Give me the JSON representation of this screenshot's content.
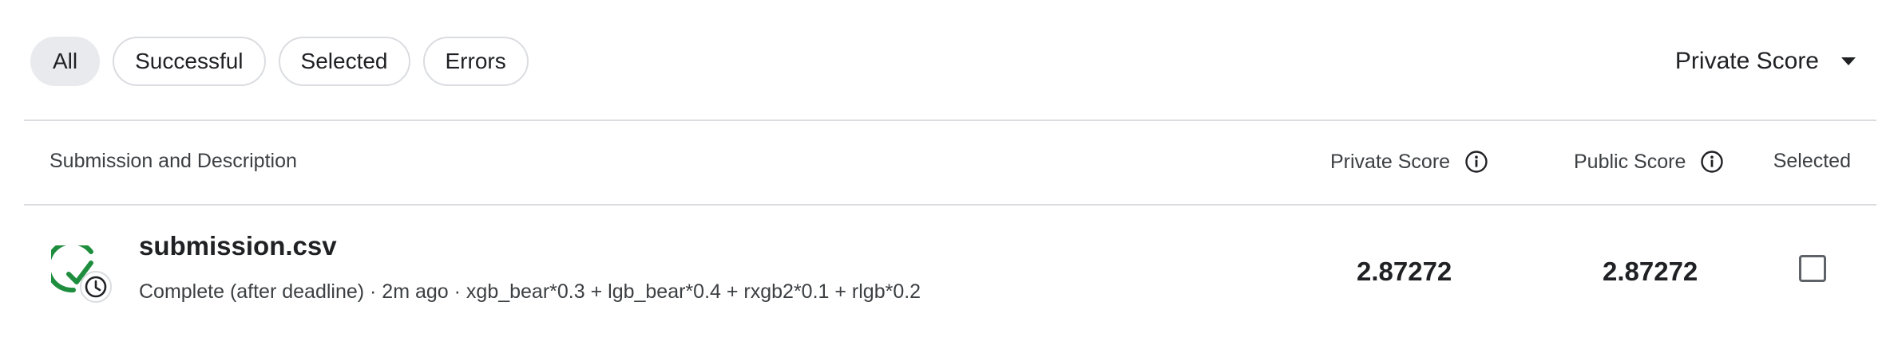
{
  "filters": {
    "all": "All",
    "successful": "Successful",
    "selected": "Selected",
    "errors": "Errors",
    "active": "All"
  },
  "sort": {
    "label": "Private Score",
    "icon": "caret-down-icon"
  },
  "table": {
    "headers": {
      "submission": "Submission and Description",
      "private_score": "Private Score",
      "public_score": "Public Score",
      "selected": "Selected"
    },
    "rows": [
      {
        "file_name": "submission.csv",
        "status": "Complete (after deadline)",
        "age": "2m ago",
        "description": "xgb_bear*0.3 + lgb_bear*0.4 + rxgb2*0.1 + rlgb*0.2",
        "meta_line": "Complete (after deadline) · 2m ago · xgb_bear*0.3 + lgb_bear*0.4 + rxgb2*0.1 + rlgb*0.2",
        "private_score": "2.87272",
        "public_score": "2.87272",
        "selected": false,
        "status_icon": "success-late-icon"
      }
    ]
  },
  "colors": {
    "success_green": "#1e8e3e",
    "divider": "#dadce0",
    "chip_active_bg": "#e8eaed"
  }
}
